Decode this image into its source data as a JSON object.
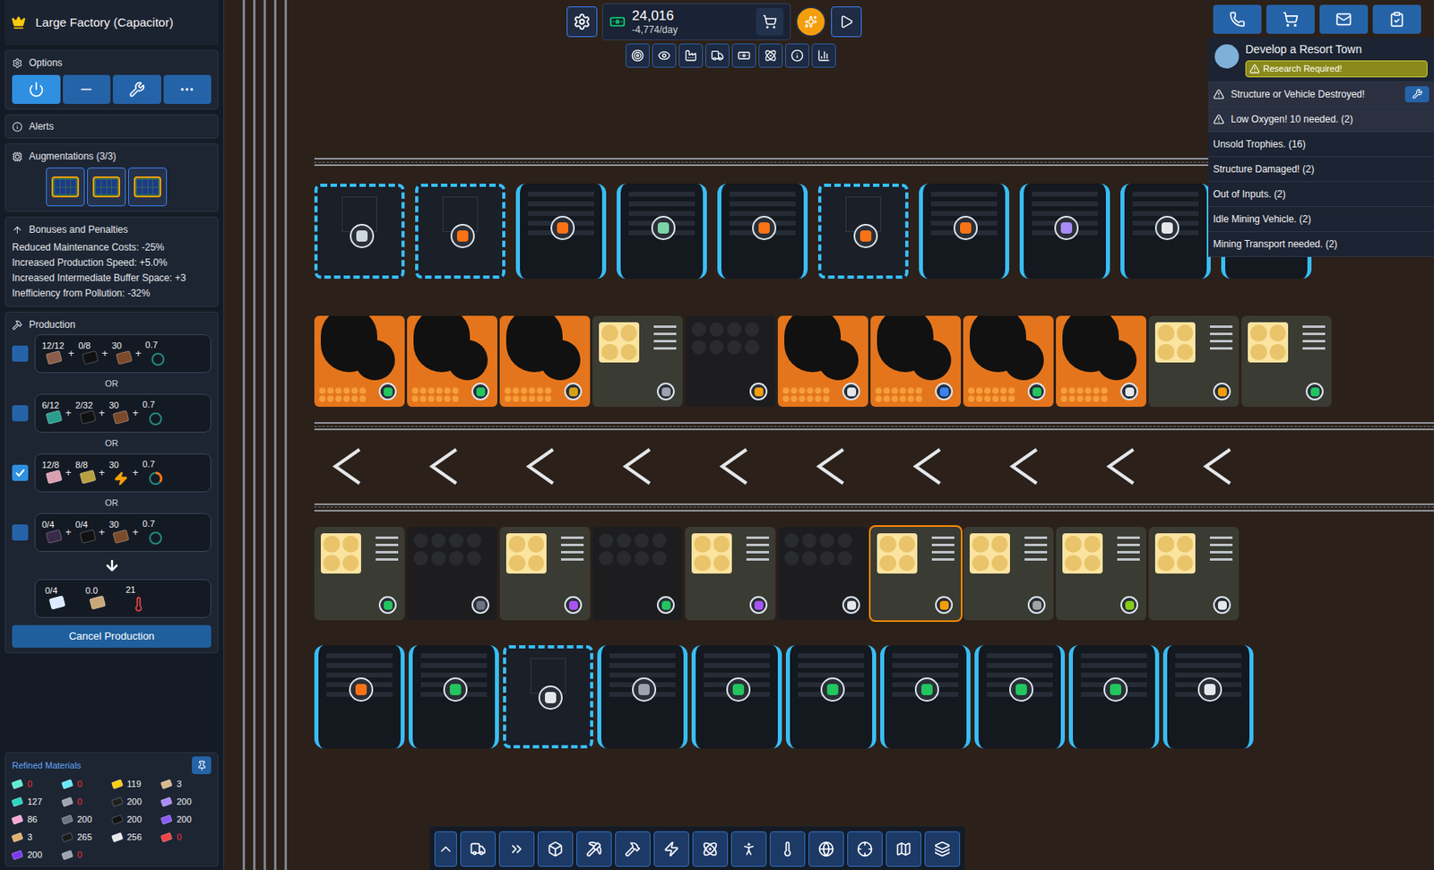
{
  "panel": {
    "title": "Large Factory (Capacitor)",
    "options": {
      "title": "Options",
      "buttons": [
        {
          "selected": true
        },
        {
          "selected": false
        },
        {
          "selected": false
        },
        {
          "selected": false
        }
      ]
    },
    "alerts": {
      "title": "Alerts"
    },
    "augmentations": {
      "title": "Augmentations (3/3)",
      "slots": [
        {
          "filled": true
        },
        {
          "filled": true
        },
        {
          "filled": true
        }
      ]
    },
    "bonuses": {
      "title": "Bonuses and Penalties",
      "items": [
        "Reduced Maintenance Costs: -25%",
        "Increased Production Speed: +5.0%",
        "Increased Intermediate Buffer Space: +3",
        "Inefficiency from Pollution: -32%"
      ]
    },
    "production": {
      "title": "Production",
      "separator": "OR",
      "plus": "+",
      "recipes": [
        {
          "checked": false,
          "inputs": [
            {
              "amount": "12/12",
              "kind": "item",
              "color": "#8b5e4a"
            },
            {
              "amount": "0/8",
              "kind": "item",
              "color": "#111111"
            },
            {
              "amount": "30",
              "kind": "item",
              "color": "#7a4a2a"
            },
            {
              "amount": "0.7",
              "kind": "gauge",
              "color": "#2dd4bf",
              "level": 0
            }
          ]
        },
        {
          "checked": false,
          "inputs": [
            {
              "amount": "6/12",
              "kind": "item",
              "color": "#2a9d8f"
            },
            {
              "amount": "2/32",
              "kind": "item",
              "color": "#111111"
            },
            {
              "amount": "30",
              "kind": "item",
              "color": "#7a4a2a"
            },
            {
              "amount": "0.7",
              "kind": "gauge",
              "color": "#2dd4bf",
              "level": 0
            }
          ]
        },
        {
          "checked": true,
          "inputs": [
            {
              "amount": "12/8",
              "kind": "item",
              "color": "#d9a0b0"
            },
            {
              "amount": "8/8",
              "kind": "item",
              "color": "#b8a040"
            },
            {
              "amount": "30",
              "kind": "power",
              "color": "#f59e0b"
            },
            {
              "amount": "0.7",
              "kind": "gauge",
              "color": "#f97316",
              "level": 0.35
            }
          ]
        },
        {
          "checked": false,
          "inputs": [
            {
              "amount": "0/4",
              "kind": "item",
              "color": "#3a2a4a"
            },
            {
              "amount": "0/4",
              "kind": "item",
              "color": "#111111"
            },
            {
              "amount": "30",
              "kind": "item",
              "color": "#7a4a2a"
            },
            {
              "amount": "0.7",
              "kind": "gauge",
              "color": "#2dd4bf",
              "level": 0
            }
          ]
        }
      ],
      "output": [
        {
          "amount": "0/4",
          "kind": "item",
          "color": "#dbeafe"
        },
        {
          "amount": "0.0",
          "kind": "item",
          "color": "#c8a878"
        },
        {
          "amount": "21",
          "kind": "heat",
          "color": "#ef4444"
        }
      ],
      "cancel": "Cancel Production"
    },
    "materials": {
      "title": "Refined Materials",
      "items": [
        {
          "amount": "0",
          "low": true,
          "color": "#5eead4"
        },
        {
          "amount": "0",
          "low": true,
          "color": "#67e8f9"
        },
        {
          "amount": "119",
          "low": false,
          "color": "#facc15"
        },
        {
          "amount": "3",
          "low": false,
          "color": "#d6b98c"
        },
        {
          "amount": "127",
          "low": false,
          "color": "#2dd4bf"
        },
        {
          "amount": "0",
          "low": true,
          "color": "#9ca3af"
        },
        {
          "amount": "200",
          "low": false,
          "color": "#1f1f1f"
        },
        {
          "amount": "200",
          "low": false,
          "color": "#a78bfa"
        },
        {
          "amount": "86",
          "low": false,
          "color": "#f9a8d4"
        },
        {
          "amount": "200",
          "low": false,
          "color": "#6b7280"
        },
        {
          "amount": "200",
          "low": false,
          "color": "#111111"
        },
        {
          "amount": "200",
          "low": false,
          "color": "#8b5cf6"
        },
        {
          "amount": "3",
          "low": false,
          "color": "#e0b070"
        },
        {
          "amount": "265",
          "low": false,
          "color": "#1a1a1a"
        },
        {
          "amount": "256",
          "low": false,
          "color": "#e5e7eb"
        },
        {
          "amount": "0",
          "low": true,
          "color": "#ef4444"
        },
        {
          "amount": "200",
          "low": false,
          "color": "#7c3aed"
        },
        {
          "amount": "0",
          "low": true,
          "color": "#9ca3af"
        }
      ]
    }
  },
  "topbar": {
    "money": "24,016",
    "rate": "-4,774/day"
  },
  "quest": {
    "title": "Develop a Resort Town",
    "status": "Research Required!"
  },
  "notifications": [
    {
      "text": "Structure or Vehicle Destroyed!",
      "warning": true,
      "action": true
    },
    {
      "text": "Low Oxygen! 10 needed. (2)",
      "warning": true,
      "action": false
    },
    {
      "text": "Unsold Trophies. (16)",
      "warning": false,
      "action": false
    },
    {
      "text": "Structure Damaged! (2)",
      "warning": false,
      "action": false
    },
    {
      "text": "Out of Inputs. (2)",
      "warning": false,
      "action": false
    },
    {
      "text": "Idle Mining Vehicle. (2)",
      "warning": false,
      "action": false
    },
    {
      "text": "Mining Transport needed. (2)",
      "warning": false,
      "action": false
    }
  ],
  "map": {
    "rows": [
      {
        "buildings": [
          {
            "kind": "storage",
            "color": "#cfd8dc",
            "selected": false
          },
          {
            "kind": "storage",
            "color": "#f97316",
            "selected": false
          },
          {
            "kind": "mine",
            "color": "#f97316",
            "selected": false
          },
          {
            "kind": "mine",
            "color": "#7dd3a8",
            "selected": false
          },
          {
            "kind": "mine",
            "color": "#f97316",
            "selected": false
          },
          {
            "kind": "storage",
            "color": "#f97316",
            "selected": false
          },
          {
            "kind": "mine",
            "color": "#f97316",
            "selected": false
          },
          {
            "kind": "mine",
            "color": "#a78bfa",
            "selected": false
          },
          {
            "kind": "mine",
            "color": "#e5e7eb",
            "selected": false
          },
          {
            "kind": "mine",
            "color": "#e5e7eb",
            "selected": false
          }
        ]
      },
      {
        "buildings": [
          {
            "kind": "smelter",
            "color": "#22c55e",
            "selected": false
          },
          {
            "kind": "smelter",
            "color": "#22c55e",
            "selected": false
          },
          {
            "kind": "smelter",
            "color": "#d4a017",
            "selected": false
          },
          {
            "kind": "factory",
            "color": "#9ca3af",
            "selected": false
          },
          {
            "kind": "dark",
            "color": "#f59e0b",
            "selected": false
          },
          {
            "kind": "smelter",
            "color": "#e5e7eb",
            "selected": false
          },
          {
            "kind": "smelter",
            "color": "#3b82f6",
            "selected": false
          },
          {
            "kind": "smelter",
            "color": "#22c55e",
            "selected": false
          },
          {
            "kind": "smelter",
            "color": "#e5e7eb",
            "selected": false
          },
          {
            "kind": "factory",
            "color": "#f59e0b",
            "selected": false
          },
          {
            "kind": "factory",
            "color": "#22c55e",
            "selected": false
          }
        ]
      },
      {
        "buildings": [
          {
            "kind": "factory",
            "color": "#22c55e",
            "selected": false
          },
          {
            "kind": "dark",
            "color": "#6b7280",
            "selected": false
          },
          {
            "kind": "factory",
            "color": "#a855f7",
            "selected": false
          },
          {
            "kind": "dark",
            "color": "#22c55e",
            "selected": false
          },
          {
            "kind": "factory",
            "color": "#a855f7",
            "selected": false
          },
          {
            "kind": "dark",
            "color": "#e5e7eb",
            "selected": false
          },
          {
            "kind": "factory",
            "color": "#f59e0b",
            "selected": true
          },
          {
            "kind": "factory",
            "color": "#a3a3a3",
            "selected": false
          },
          {
            "kind": "factory",
            "color": "#84cc16",
            "selected": false
          },
          {
            "kind": "factory",
            "color": "#e5e7eb",
            "selected": false
          }
        ]
      },
      {
        "buildings": [
          {
            "kind": "mine",
            "color": "#f97316",
            "selected": false
          },
          {
            "kind": "mine",
            "color": "#22c55e",
            "selected": false
          },
          {
            "kind": "storage",
            "color": "#e5e7eb",
            "selected": false
          },
          {
            "kind": "mine",
            "color": "#9ca3af",
            "selected": false
          },
          {
            "kind": "mine",
            "color": "#22c55e",
            "selected": false
          },
          {
            "kind": "mine",
            "color": "#22c55e",
            "selected": false
          },
          {
            "kind": "mine",
            "color": "#22c55e",
            "selected": false
          },
          {
            "kind": "mine",
            "color": "#22c55e",
            "selected": false
          },
          {
            "kind": "mine",
            "color": "#22c55e",
            "selected": false
          },
          {
            "kind": "mine",
            "color": "#e5e7eb",
            "selected": false
          }
        ]
      }
    ]
  }
}
